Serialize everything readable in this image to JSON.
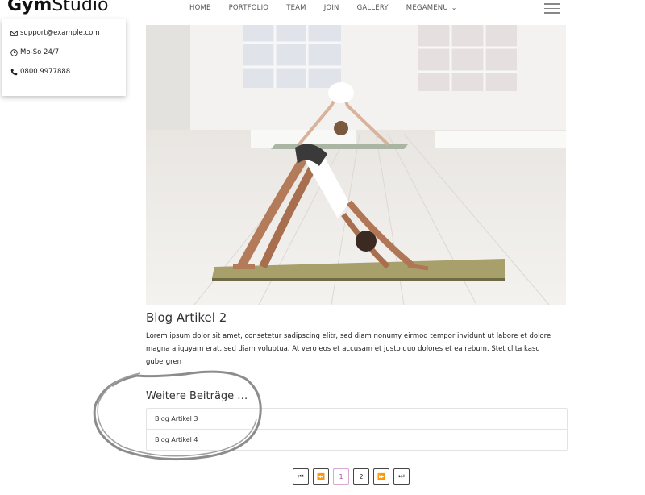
{
  "brand": {
    "bold": "Gym",
    "light": "Studio"
  },
  "nav": {
    "items": [
      "HOME",
      "PORTFOLIO",
      "TEAM",
      "JOIN",
      "GALLERY",
      "MEGAMENU"
    ]
  },
  "contact": {
    "email": "support@example.com",
    "hours": "Mo-So 24/7",
    "phone": "0800.9977888"
  },
  "post": {
    "title": "Blog Artikel 2",
    "text": "Lorem ipsum dolor sit amet, consetetur sadipscing elitr, sed diam nonumy eirmod tempor invidunt ut labore et dolore magna aliquyam erat, sed diam voluptua. At vero eos et accusam et justo duo dolores et ea rebum. Stet clita kasd gubergren"
  },
  "more": {
    "title": "Weitere Beiträge …",
    "items": [
      "Blog Artikel 3",
      "Blog Artikel 4"
    ]
  },
  "pagination": {
    "first": "⏮",
    "prev": "⏪",
    "pages": [
      "1",
      "2"
    ],
    "current": "1",
    "next": "⏩",
    "last": "⏭"
  },
  "colors": {
    "accent": "#a24ea0",
    "annotation": "#8c8c8c"
  }
}
